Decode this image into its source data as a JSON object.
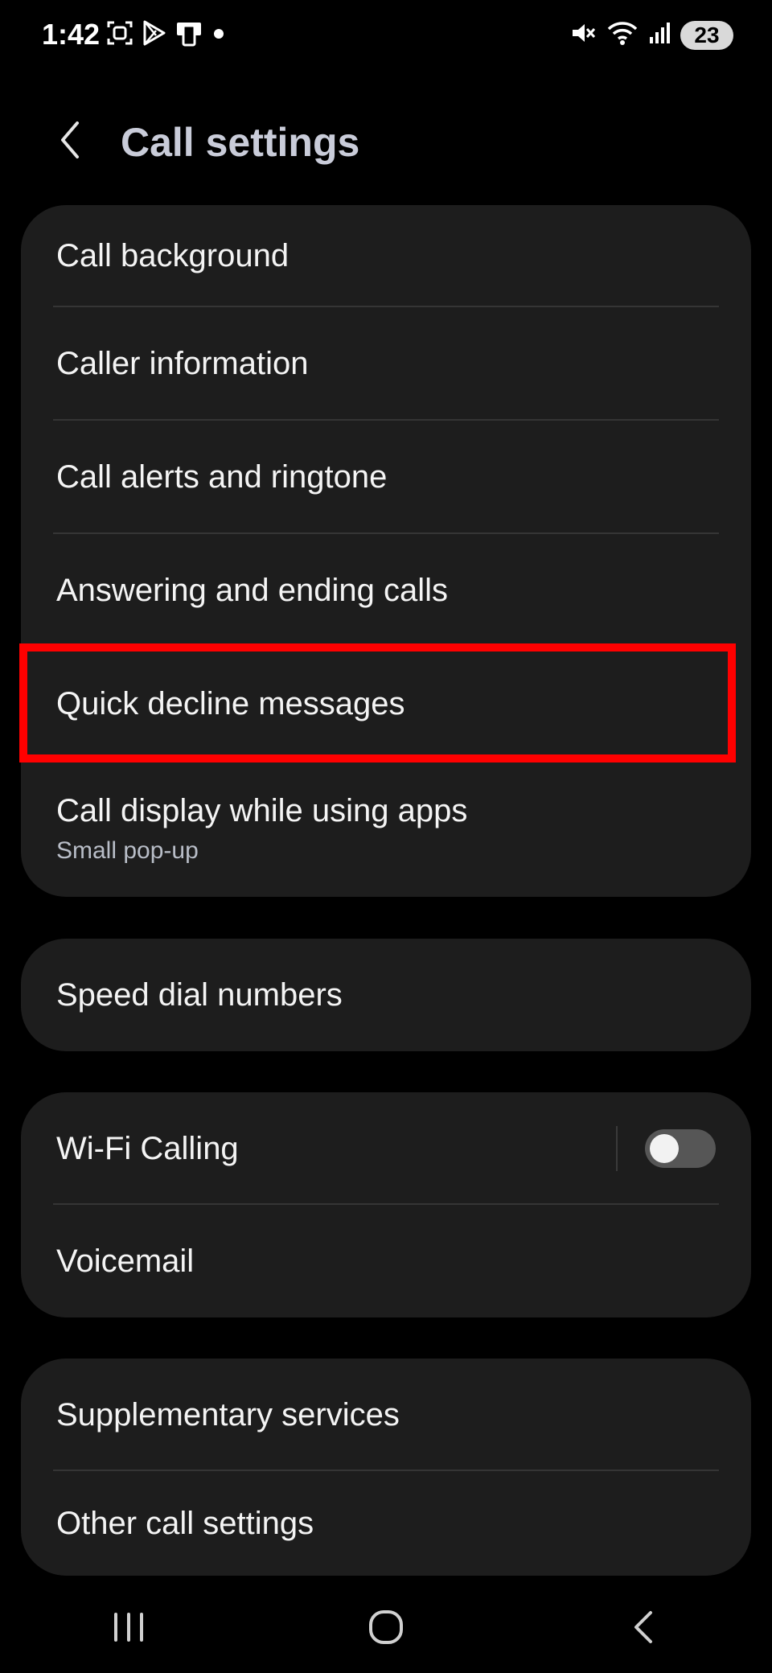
{
  "status_bar": {
    "time": "1:42",
    "battery_level": "23",
    "left_icons": [
      "screenshot-icon",
      "play-store-icon",
      "device-icon",
      "dot-icon"
    ],
    "right_icons": [
      "mute-icon",
      "wifi-icon",
      "signal-icon"
    ]
  },
  "header": {
    "title": "Call settings",
    "back_icon": "back-arrow-icon"
  },
  "groups": [
    {
      "items": [
        {
          "label": "Call background"
        },
        {
          "label": "Caller information"
        },
        {
          "label": "Call alerts and ringtone"
        },
        {
          "label": "Answering and ending calls"
        },
        {
          "label": "Quick decline messages",
          "highlighted": true
        },
        {
          "label": "Call display while using apps",
          "subtitle": "Small pop-up"
        }
      ]
    },
    {
      "items": [
        {
          "label": "Speed dial numbers"
        }
      ]
    },
    {
      "items": [
        {
          "label": "Wi-Fi Calling",
          "toggle": "off"
        },
        {
          "label": "Voicemail"
        }
      ]
    },
    {
      "items": [
        {
          "label": "Supplementary services"
        },
        {
          "label": "Other call settings"
        }
      ]
    }
  ],
  "highlight_color": "#ff0000",
  "nav_bar": {
    "buttons": [
      "recent-apps-icon",
      "home-icon",
      "back-icon"
    ]
  }
}
